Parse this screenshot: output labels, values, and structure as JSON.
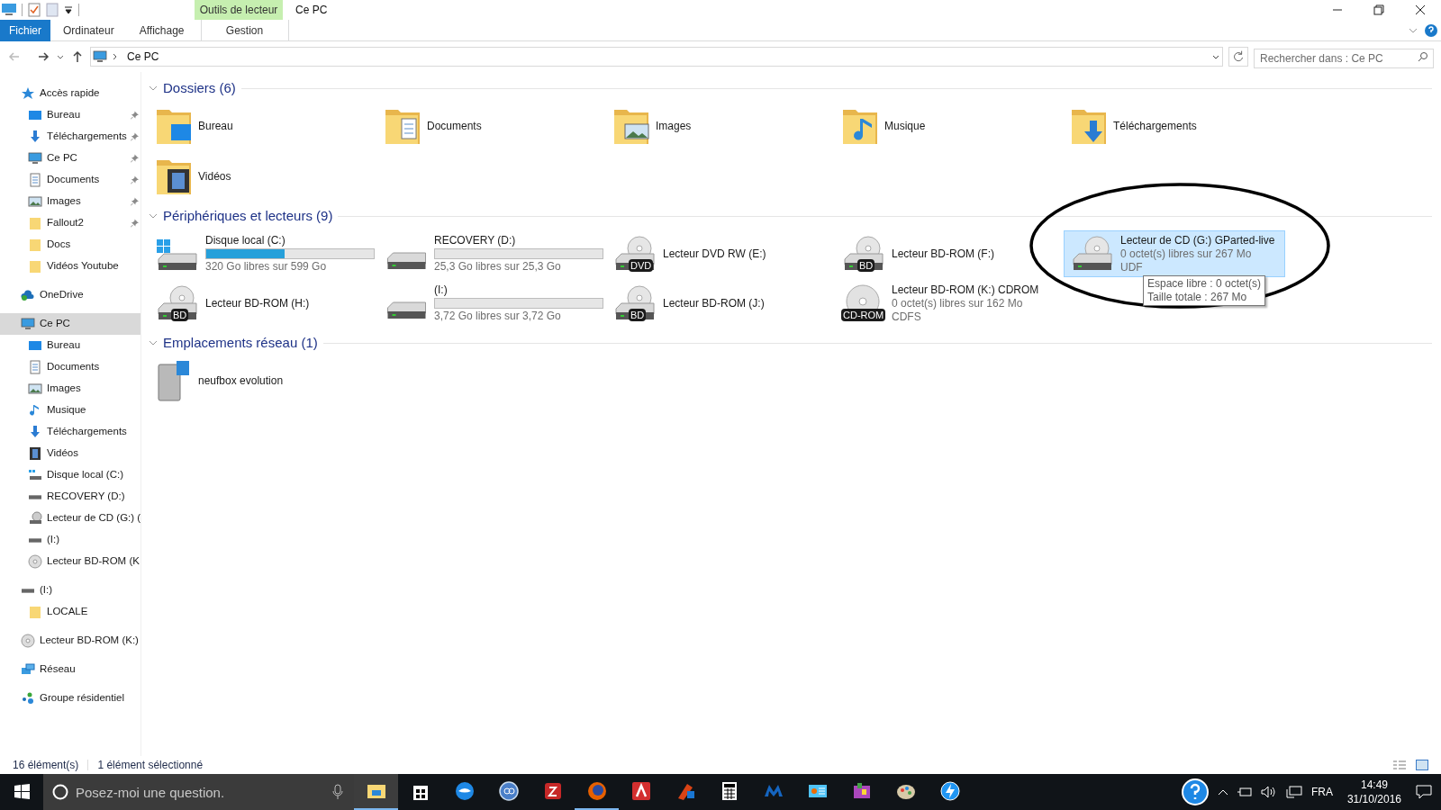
{
  "window": {
    "title": "Ce PC",
    "context_group": "Outils de lecteur"
  },
  "ribbon_tabs": [
    {
      "label": "Fichier",
      "kind": "file",
      "selected": false
    },
    {
      "label": "Ordinateur",
      "kind": "tab",
      "selected": false
    },
    {
      "label": "Affichage",
      "kind": "tab",
      "selected": false
    },
    {
      "label": "Gestion",
      "kind": "context",
      "selected": false
    }
  ],
  "address": {
    "path": "Ce PC",
    "search_placeholder": "Rechercher dans : Ce PC"
  },
  "sidebar": {
    "items": [
      {
        "label": "Accès rapide",
        "kind": "star",
        "selected": false,
        "pinned": false,
        "children": [
          {
            "label": "Bureau",
            "kind": "desktop",
            "selected": false,
            "pinned": true
          },
          {
            "label": "Téléchargements",
            "kind": "download",
            "selected": false,
            "pinned": true
          },
          {
            "label": "Ce PC",
            "kind": "pc",
            "selected": false,
            "pinned": true
          },
          {
            "label": "Documents",
            "kind": "document",
            "selected": false,
            "pinned": true
          },
          {
            "label": "Images",
            "kind": "picture",
            "selected": false,
            "pinned": true
          },
          {
            "label": "Fallout2",
            "kind": "folder",
            "selected": false,
            "pinned": true
          },
          {
            "label": "Docs",
            "kind": "folder",
            "selected": false,
            "pinned": false
          },
          {
            "label": "Vidéos Youtube",
            "kind": "folder",
            "selected": false,
            "pinned": false
          }
        ]
      },
      {
        "label": "OneDrive",
        "kind": "cloud",
        "selected": false,
        "pinned": false
      },
      {
        "label": "Ce PC",
        "kind": "pc",
        "selected": true,
        "pinned": false,
        "children": [
          {
            "label": "Bureau",
            "kind": "desktop",
            "selected": false,
            "pinned": false
          },
          {
            "label": "Documents",
            "kind": "document",
            "selected": false,
            "pinned": false
          },
          {
            "label": "Images",
            "kind": "picture",
            "selected": false,
            "pinned": false
          },
          {
            "label": "Musique",
            "kind": "music",
            "selected": false,
            "pinned": false
          },
          {
            "label": "Téléchargements",
            "kind": "download",
            "selected": false,
            "pinned": false
          },
          {
            "label": "Vidéos",
            "kind": "video",
            "selected": false,
            "pinned": false
          },
          {
            "label": "Disque local (C:)",
            "kind": "windrive",
            "selected": false,
            "pinned": false
          },
          {
            "label": "RECOVERY (D:)",
            "kind": "drive",
            "selected": false,
            "pinned": false
          },
          {
            "label": "Lecteur de CD (G:) (",
            "kind": "cddrive",
            "selected": false,
            "pinned": false
          },
          {
            "label": "(I:)",
            "kind": "drive",
            "selected": false,
            "pinned": false
          },
          {
            "label": "Lecteur BD-ROM (K",
            "kind": "disc",
            "selected": false,
            "pinned": false
          }
        ]
      },
      {
        "label": "(I:)",
        "kind": "drive",
        "selected": false,
        "pinned": false,
        "children": [
          {
            "label": "LOCALE",
            "kind": "folder",
            "selected": false,
            "pinned": false
          }
        ]
      },
      {
        "label": "Lecteur BD-ROM (K:)",
        "kind": "disc",
        "selected": false,
        "pinned": false
      },
      {
        "label": "Réseau",
        "kind": "network",
        "selected": false,
        "pinned": false
      },
      {
        "label": "Groupe résidentiel",
        "kind": "homegroup",
        "selected": false,
        "pinned": false
      }
    ]
  },
  "sections": [
    {
      "title": "Dossiers (6)",
      "kind": "folders",
      "items": [
        {
          "name": "Bureau",
          "kind": "desktop",
          "selected": false
        },
        {
          "name": "Documents",
          "kind": "document",
          "selected": false
        },
        {
          "name": "Images",
          "kind": "picture",
          "selected": false
        },
        {
          "name": "Musique",
          "kind": "music",
          "selected": false
        },
        {
          "name": "Téléchargements",
          "kind": "download",
          "selected": false
        },
        {
          "name": "Vidéos",
          "kind": "video",
          "selected": false
        }
      ]
    },
    {
      "title": "Périphériques et lecteurs (9)",
      "kind": "drives",
      "items": [
        {
          "name": "Disque local (C:)",
          "kind": "windrive",
          "level": 0.47,
          "free": "320 Go libres sur 599 Go",
          "selected": false
        },
        {
          "name": "RECOVERY (D:)",
          "kind": "drive",
          "level": 0,
          "free": "25,3 Go libres sur 25,3 Go",
          "selected": false
        },
        {
          "name": "Lecteur DVD RW (E:)",
          "kind": "optical",
          "badge": "DVD",
          "selected": false
        },
        {
          "name": "Lecteur BD-ROM (F:)",
          "kind": "optical",
          "badge": "BD",
          "selected": false
        },
        {
          "name": "Lecteur de CD (G:) GParted-live",
          "kind": "cddrive",
          "free": "0 octet(s) libres sur 267 Mo",
          "fs": "UDF",
          "selected": true,
          "tooltip": [
            "Espace libre : 0 octet(s)",
            "Taille totale : 267 Mo"
          ]
        },
        {
          "name": "Lecteur BD-ROM (H:)",
          "kind": "optical",
          "badge": "BD",
          "selected": false
        },
        {
          "name": "(I:)",
          "kind": "drive",
          "level": 0,
          "free": "3,72 Go libres sur 3,72 Go",
          "selected": false
        },
        {
          "name": "Lecteur BD-ROM (J:)",
          "kind": "optical",
          "badge": "BD",
          "selected": false
        },
        {
          "name": "Lecteur BD-ROM (K:) CDROM",
          "kind": "disc",
          "badge": "CD-ROM",
          "free": "0 octet(s) libres sur 162 Mo",
          "fs": "CDFS",
          "selected": false
        }
      ]
    },
    {
      "title": "Emplacements réseau (1)",
      "kind": "network",
      "items": [
        {
          "name": "neufbox evolution",
          "kind": "router",
          "selected": false
        }
      ]
    }
  ],
  "status_bar": {
    "count": "16 élément(s)",
    "selection": "1 élément sélectionné"
  },
  "taskbar": {
    "search_placeholder": "Posez-moi une question.",
    "apps": [
      {
        "kind": "explorer",
        "active": true,
        "running": true
      },
      {
        "kind": "store",
        "active": false,
        "running": false
      },
      {
        "kind": "bird",
        "active": false,
        "running": false
      },
      {
        "kind": "qb",
        "active": false,
        "running": false
      },
      {
        "kind": "game",
        "active": false,
        "running": false
      },
      {
        "kind": "firefox",
        "active": false,
        "running": true
      },
      {
        "kind": "avira",
        "active": false,
        "running": false
      },
      {
        "kind": "cleaner",
        "active": false,
        "running": false
      },
      {
        "kind": "calculator",
        "active": false,
        "running": false
      },
      {
        "kind": "malware",
        "active": false,
        "running": false
      },
      {
        "kind": "card",
        "active": false,
        "running": false
      },
      {
        "kind": "box",
        "active": false,
        "running": false
      },
      {
        "kind": "paint",
        "active": false,
        "running": false
      },
      {
        "kind": "bolt",
        "active": false,
        "running": false
      }
    ],
    "language": "FRA",
    "time": "14:49",
    "date": "31/10/2016"
  }
}
